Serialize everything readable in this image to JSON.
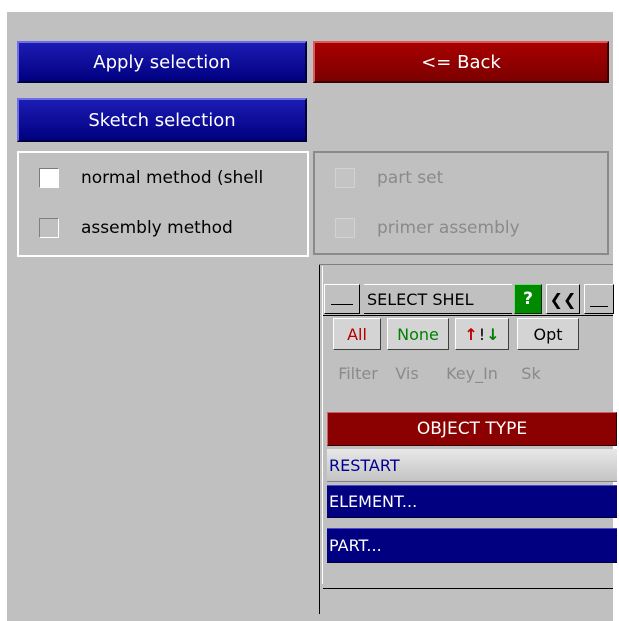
{
  "buttons": {
    "apply_selection": "Apply selection",
    "back": "<= Back",
    "sketch_selection": "Sketch selection"
  },
  "method_group": {
    "items": [
      {
        "label": "normal method (shell",
        "checked": true
      },
      {
        "label": "assembly method",
        "checked": false
      }
    ]
  },
  "set_group": {
    "items": [
      {
        "label": "part set",
        "disabled": true
      },
      {
        "label": "primer assembly",
        "disabled": true
      }
    ]
  },
  "select_panel": {
    "title": "SELECT SHEL",
    "help_label": "?",
    "collapse_label": "❮❮",
    "row1": {
      "all": "All",
      "none": "None",
      "swap_up": "↑",
      "swap_sep": "!",
      "swap_down": "↓",
      "opt": "Opt"
    },
    "row2": {
      "filter": "Filter",
      "vis": "Vis",
      "key_in": "Key_In",
      "sk": "Sk"
    },
    "list_header": "OBJECT TYPE",
    "list_items": [
      "RESTART",
      "ELEMENT...",
      "PART..."
    ]
  },
  "colors": {
    "panel_bg": "#c0c0c0",
    "button_blue": "#000080",
    "button_red": "#8b0000",
    "help_green": "#008000",
    "list_text_blue": "#000090",
    "all_red": "#b40000",
    "none_green": "#008000"
  }
}
